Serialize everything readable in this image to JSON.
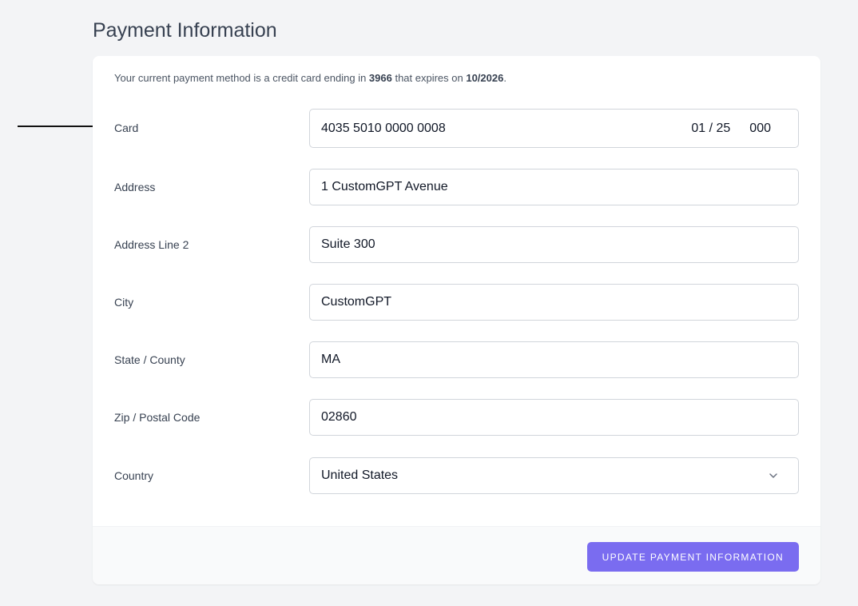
{
  "page": {
    "title": "Payment Information"
  },
  "notice": {
    "prefix": "Your current payment method is a credit card ending in ",
    "last4": "3966",
    "middle": " that expires on ",
    "expiry": "10/2026",
    "suffix": "."
  },
  "form": {
    "card": {
      "label": "Card",
      "number": "4035 5010 0000 0008",
      "expiry": "01 / 25",
      "cvc": "000"
    },
    "address": {
      "label": "Address",
      "value": "1 CustomGPT Avenue"
    },
    "address2": {
      "label": "Address Line 2",
      "value": "Suite 300"
    },
    "city": {
      "label": "City",
      "value": "CustomGPT"
    },
    "state": {
      "label": "State / County",
      "value": "MA"
    },
    "zip": {
      "label": "Zip / Postal Code",
      "value": "02860"
    },
    "country": {
      "label": "Country",
      "value": "United States"
    }
  },
  "footer": {
    "update_label": "UPDATE PAYMENT INFORMATION"
  },
  "colors": {
    "accent": "#7a6cf0",
    "background": "#f3f4f6",
    "card": "#ffffff"
  },
  "icons": {
    "country_select": "chevron-down-icon",
    "annotation": "arrow-right-icon"
  }
}
